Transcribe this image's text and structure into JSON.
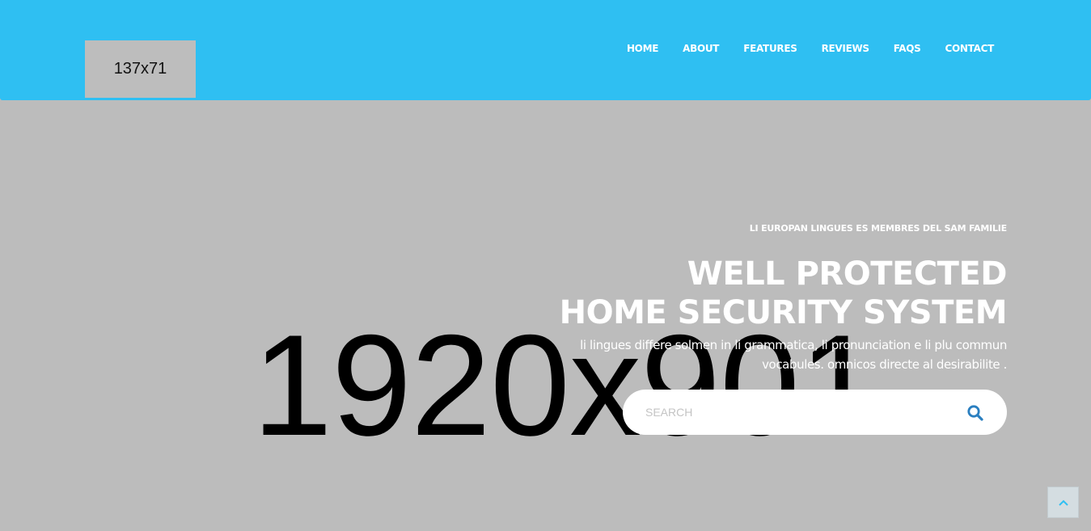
{
  "colors": {
    "navbar": "#2fbff2",
    "hero_background": "#bcbcbc",
    "search_icon": "#2a7fc0",
    "scroll_top_bg": "#d4dde1",
    "scroll_top_icon": "#2fbff2"
  },
  "logo": {
    "placeholder_text": "137x71"
  },
  "nav": {
    "items": [
      {
        "label": "HOME"
      },
      {
        "label": "ABOUT"
      },
      {
        "label": "FEATURES"
      },
      {
        "label": "REVIEWS"
      },
      {
        "label": "FAQS"
      },
      {
        "label": "CONTACT"
      }
    ]
  },
  "background": {
    "placeholder_text": "1920x901"
  },
  "hero": {
    "subtitle": "LI EUROPAN LINGUES ES MEMBRES DEL SAM FAMILIE",
    "title_line1": "WELL PROTECTED",
    "title_line2": "HOME SECURITY SYSTEM",
    "desc_line1": "li lingues differe solmen in li grammatica, li pronunciation e li plu commun",
    "desc_line2": "vocabules. omnicos directe al desirabilite ."
  },
  "search": {
    "placeholder": "SEARCH",
    "icon": "search-icon"
  },
  "scroll_top": {
    "icon": "chevron-up-icon"
  }
}
